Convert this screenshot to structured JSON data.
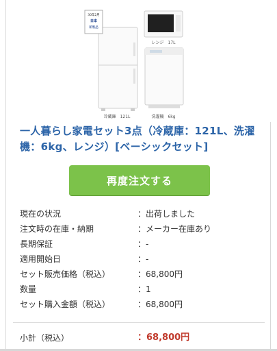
{
  "product": {
    "fridge_badge": "30年2月\n日本\n新製品",
    "fridge_caption": "冷蔵庫　121L",
    "microwave_caption": "レンジ　17L",
    "washer_caption": "洗濯機　6kg",
    "title": "一人暮らし家電セット3点（冷蔵庫：121L、洗濯機：6kg、レンジ）[ベーシックセット]"
  },
  "actions": {
    "reorder_label": "再度注文する"
  },
  "details": [
    {
      "label": "現在の状況",
      "value": "：出荷しました"
    },
    {
      "label": "注文時の在庫・納期",
      "value": "：メーカー在庫あり"
    },
    {
      "label": "長期保証",
      "value": "：-"
    },
    {
      "label": "適用開始日",
      "value": "：-"
    },
    {
      "label": "セット販売価格（税込）",
      "value": "：68,800円"
    },
    {
      "label": "数量",
      "value": "：1"
    },
    {
      "label": "セット購入金額（税込）",
      "value": "：68,800円"
    }
  ],
  "subtotal": {
    "label": "小計（税込）",
    "value": "：68,800円"
  },
  "colors": {
    "title": "#2c64a8",
    "button": "#7cc24a",
    "price": "#c0392b"
  }
}
